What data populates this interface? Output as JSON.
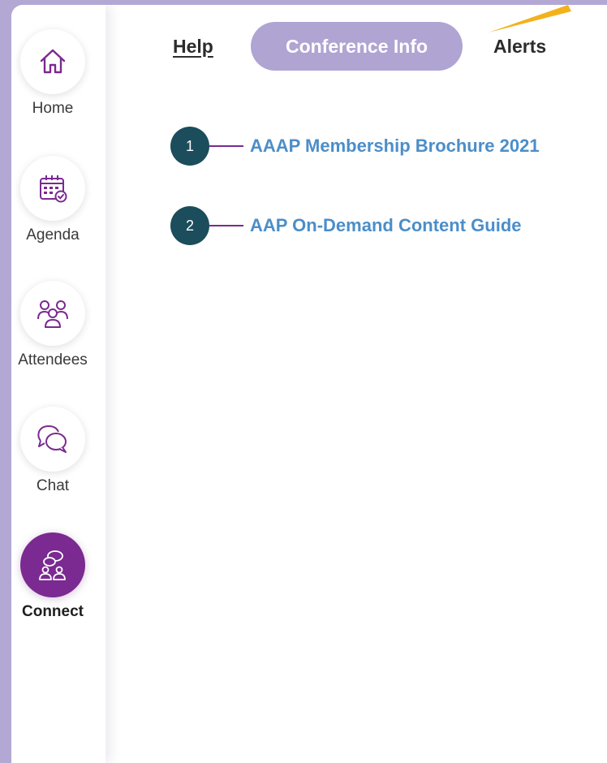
{
  "sidebar": {
    "items": [
      {
        "label": "Home",
        "icon": "home-icon"
      },
      {
        "label": "Agenda",
        "icon": "calendar-icon"
      },
      {
        "label": "Attendees",
        "icon": "people-icon"
      },
      {
        "label": "Chat",
        "icon": "chat-icon"
      },
      {
        "label": "Connect",
        "icon": "connect-icon",
        "active": true
      }
    ]
  },
  "tabs": [
    {
      "label": "Help"
    },
    {
      "label": "Conference Info",
      "active": true
    },
    {
      "label": "Alerts"
    }
  ],
  "documents": [
    {
      "number": "1",
      "title": "AAAP Membership Brochure 2021"
    },
    {
      "number": "2",
      "title": "AAP On-Demand Content Guide"
    }
  ],
  "colors": {
    "accent_purple": "#7a2a91",
    "tab_active_bg": "#b0a4d3",
    "badge_teal": "#1b4d5c",
    "link_blue": "#4b8ec9",
    "pointer_yellow": "#f3b21c"
  }
}
